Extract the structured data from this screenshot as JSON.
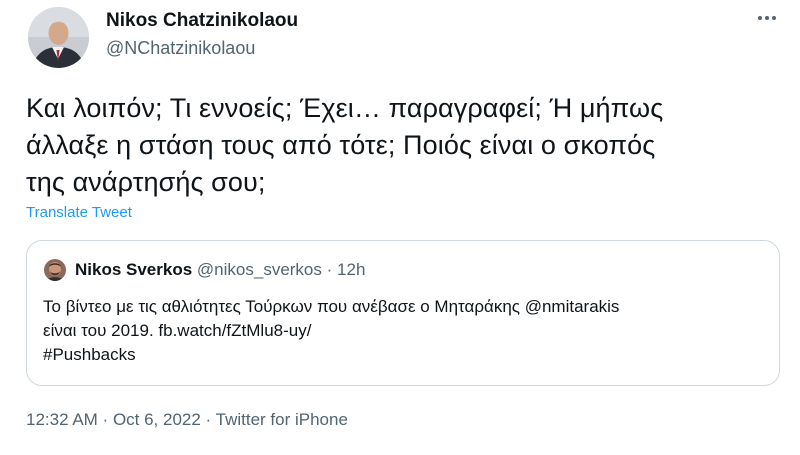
{
  "author": {
    "name": "Nikos Chatzinikolaou",
    "handle": "@NChatzinikolaou"
  },
  "tweet": {
    "lines": [
      "Και λοιπόν; Τι εννοείς; Έχει… παραγραφεί; Ή μήπως",
      "άλλαξε η στάση τους από τότε; Ποιός είναι ο σκοπός",
      "της ανάρτησής σου;"
    ],
    "translate_label": "Translate Tweet"
  },
  "quoted": {
    "name": "Nikos Sverkos",
    "handle": "@nikos_sverkos",
    "separator": "·",
    "time": "12h",
    "lines": [
      "Το βίντεο με τις αθλιότητες Τούρκων που ανέβασε ο Μηταράκης @nmitarakis",
      "είναι του 2019. fb.watch/fZtMlu8-uy/",
      "#Pushbacks"
    ]
  },
  "meta": {
    "time": "12:32 AM",
    "sep1": " · ",
    "date": "Oct 6, 2022",
    "sep2": " · ",
    "source": "Twitter for iPhone"
  },
  "colors": {
    "text": "#0f1419",
    "secondary": "#536471",
    "link": "#1d9bf0",
    "border": "#cfd9de"
  },
  "icons": {
    "more": "more-horizontal-icon"
  }
}
